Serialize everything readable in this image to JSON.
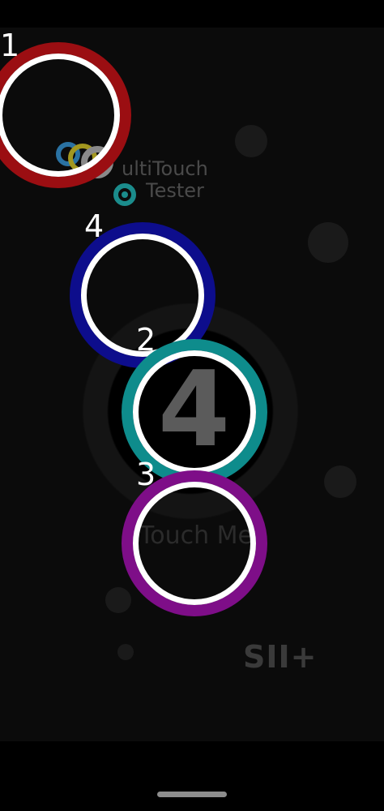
{
  "app": {
    "logo_line1": "ultiTouch",
    "logo_line2": "Tester",
    "touch_count": "4",
    "touch_prompt": "Touch Me",
    "watermark": "SII+"
  },
  "touches": [
    {
      "label": "1",
      "color": "#9b0e12"
    },
    {
      "label": "4",
      "color": "#0d0d8c"
    },
    {
      "label": "2",
      "color": "#0e8c8c"
    },
    {
      "label": "3",
      "color": "#7e0e88"
    }
  ],
  "icons": {
    "logo": "multitouch-logo-icon",
    "home_indicator": "home-bar"
  }
}
